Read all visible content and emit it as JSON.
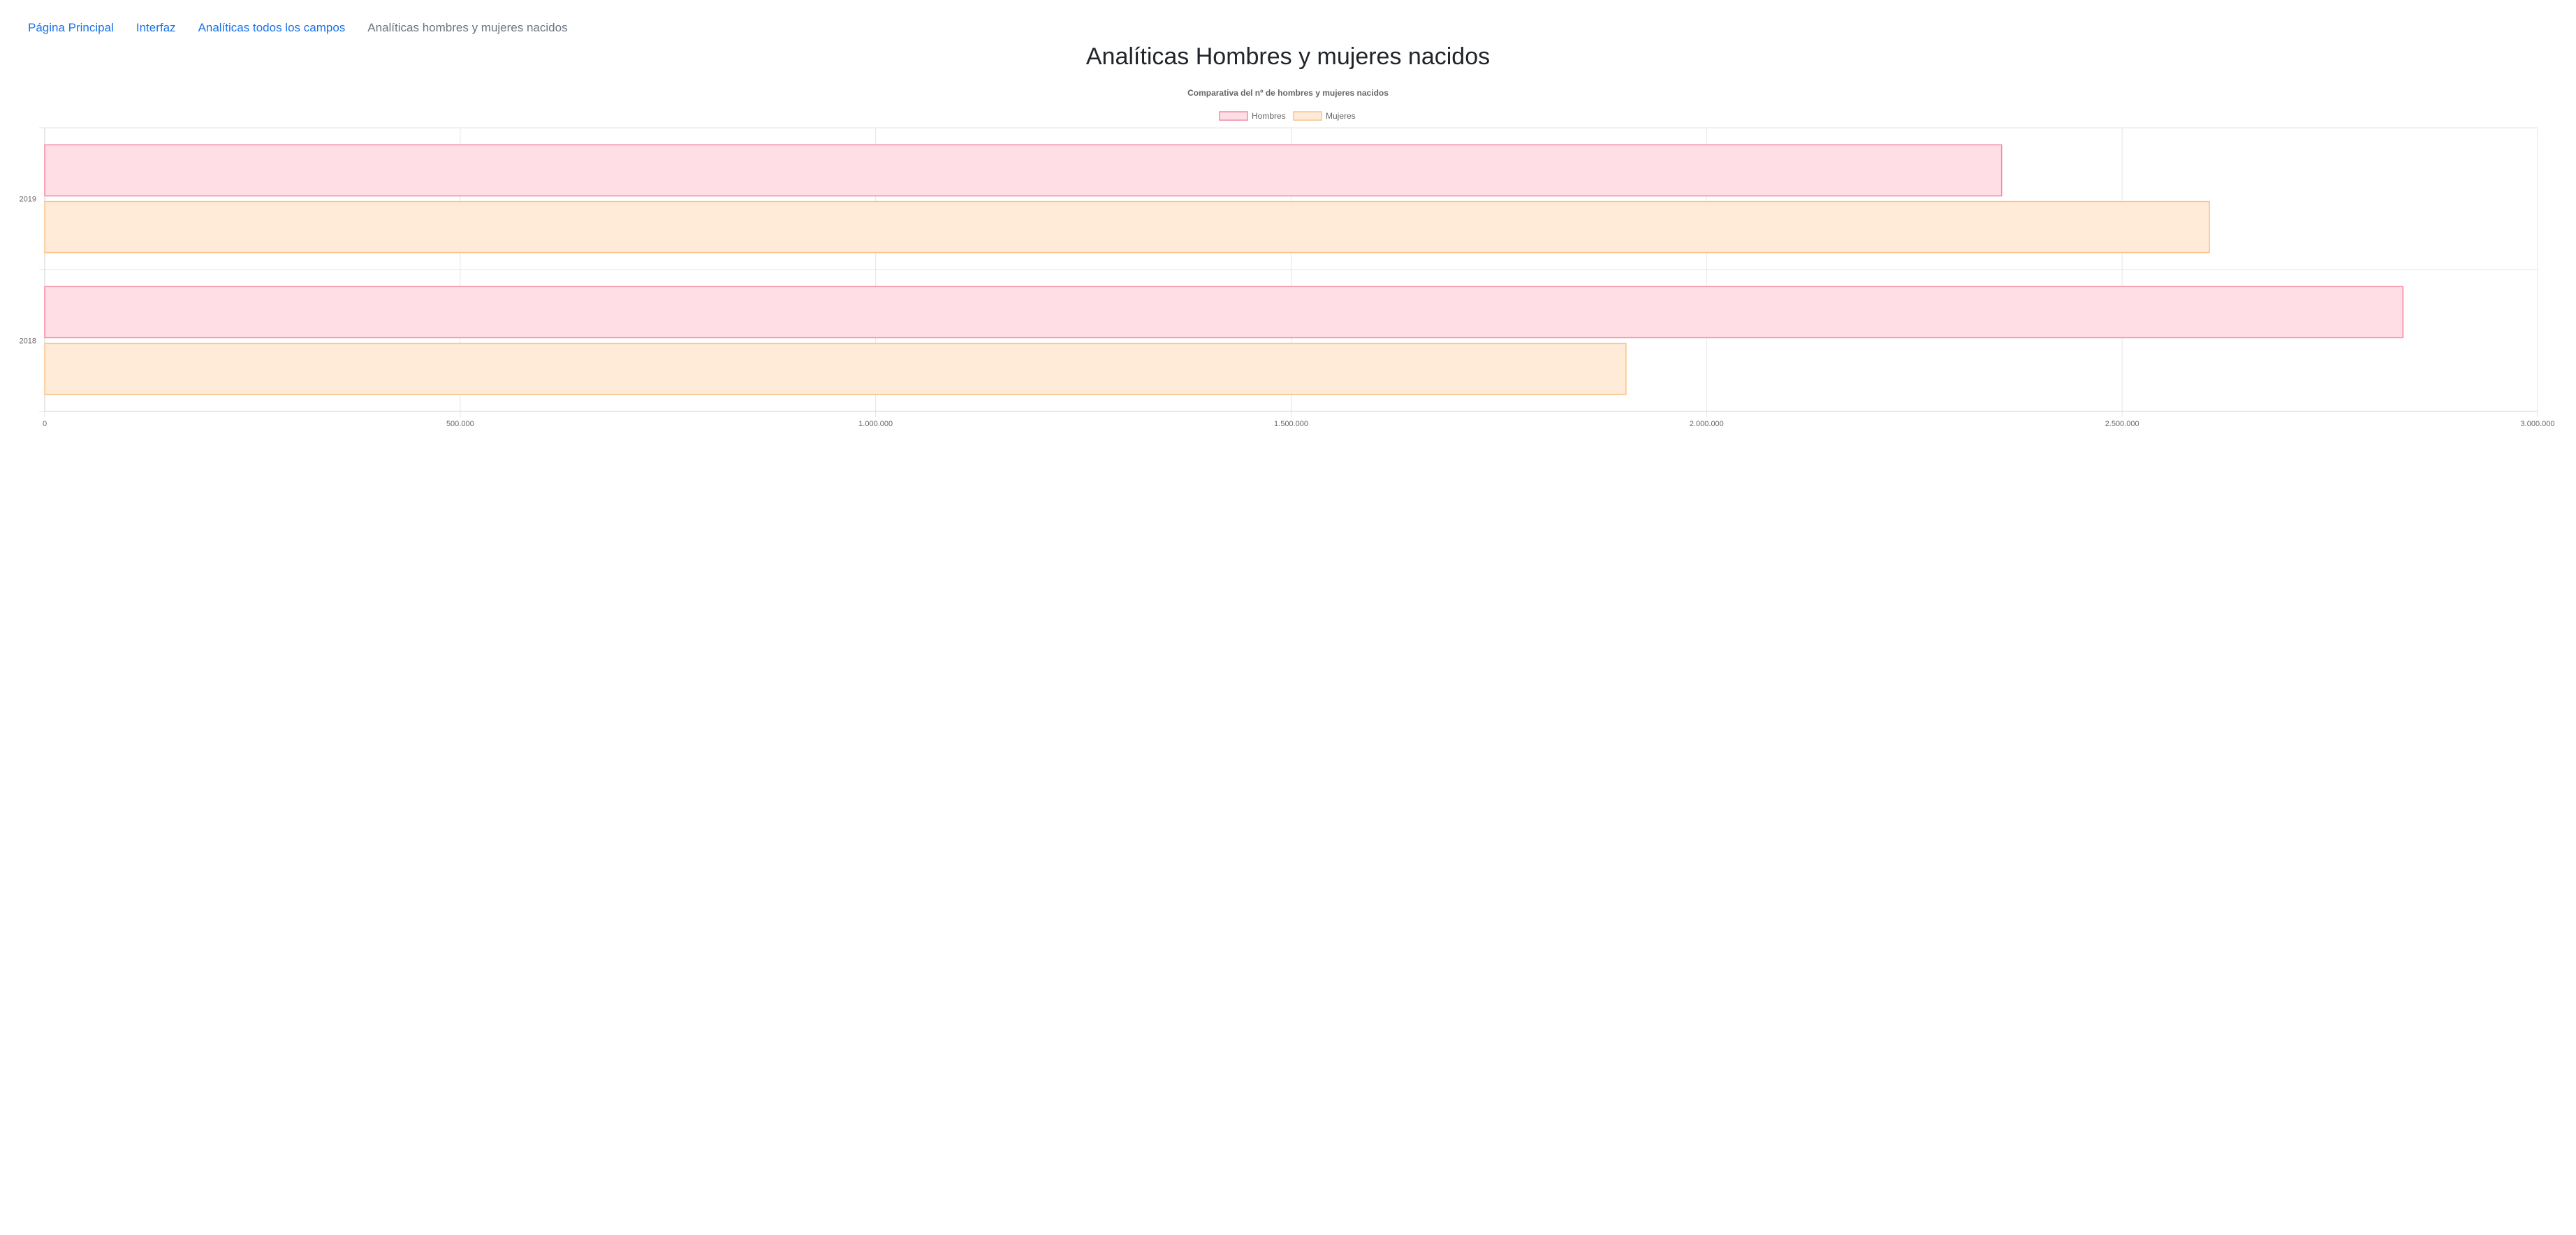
{
  "breadcrumb": {
    "items": [
      {
        "label": "Página Principal",
        "link": true
      },
      {
        "label": "Interfaz",
        "link": true
      },
      {
        "label": "Analíticas todos los campos",
        "link": true
      },
      {
        "label": "Analíticas hombres y mujeres nacidos",
        "link": false
      }
    ]
  },
  "page": {
    "title": "Analíticas Hombres y mujeres nacidos"
  },
  "colors": {
    "hombres_fill": "#ffdfe5",
    "hombres_stroke": "#f48aa3",
    "mujeres_fill": "#ffebd8",
    "mujeres_stroke": "#f8c48a",
    "link": "#1a73e8",
    "grid": "#e6e6e6"
  },
  "chart_data": {
    "type": "bar",
    "orientation": "horizontal",
    "title": "Comparativa del nº de hombres y mujeres nacidos",
    "categories": [
      "2019",
      "2018"
    ],
    "series": [
      {
        "name": "Hombres",
        "values": [
          2355000,
          2838000
        ]
      },
      {
        "name": "Mujeres",
        "values": [
          2605000,
          1903000
        ]
      }
    ],
    "xlim": [
      0,
      3000000
    ],
    "xticks": [
      0,
      500000,
      1000000,
      1500000,
      2000000,
      2500000,
      3000000
    ],
    "xtick_labels": [
      "0",
      "500.000",
      "1.000.000",
      "1.500.000",
      "2.000.000",
      "2.500.000",
      "3.000.000"
    ],
    "legend": "top-center",
    "grid": true
  }
}
